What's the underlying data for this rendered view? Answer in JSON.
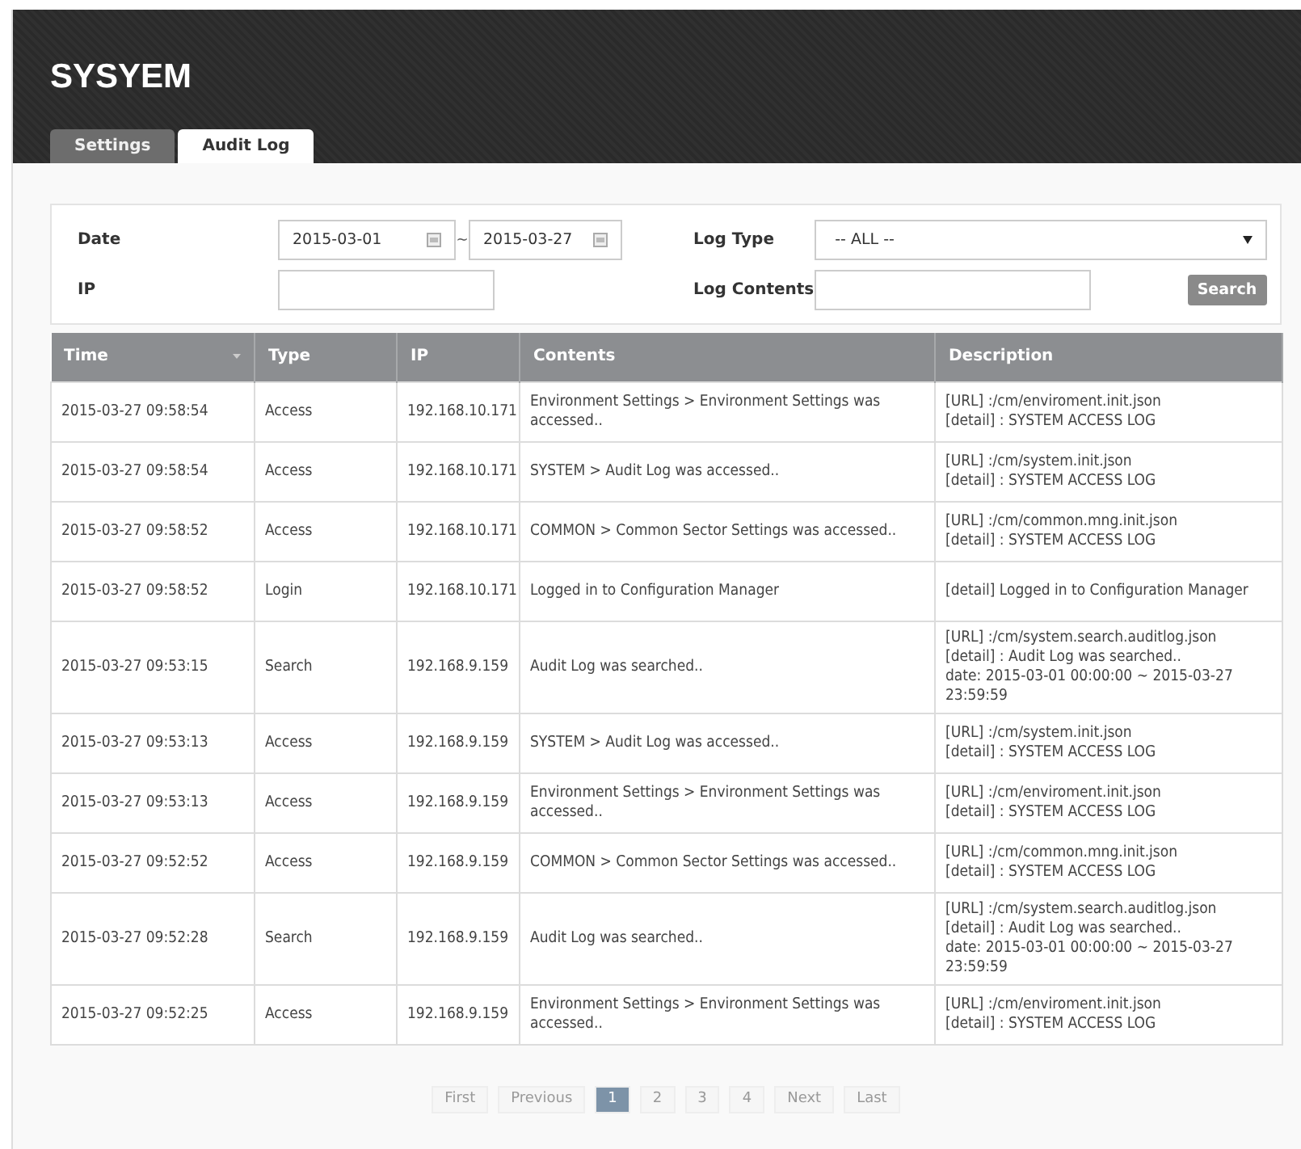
{
  "header": {
    "title": "SYSYEM"
  },
  "tabs": [
    {
      "label": "Settings",
      "selected": false
    },
    {
      "label": "Audit Log",
      "selected": true
    }
  ],
  "filters": {
    "date_label": "Date",
    "date_from": "2015-03-01",
    "date_sep": "~",
    "date_to": "2015-03-27",
    "ip_label": "IP",
    "log_type_label": "Log Type",
    "log_type_value": "-- ALL --",
    "log_contents_label": "Log Contents",
    "search_button": "Search"
  },
  "table": {
    "columns": [
      {
        "label": "Time",
        "sortable": true
      },
      {
        "label": "Type",
        "sortable": false
      },
      {
        "label": "IP",
        "sortable": false
      },
      {
        "label": "Contents",
        "sortable": false
      },
      {
        "label": "Description",
        "sortable": false
      }
    ],
    "rows": [
      {
        "time": "2015-03-27 09:58:54",
        "type": "Access",
        "ip": "192.168.10.171",
        "contents": "Environment Settings > Environment Settings was accessed..",
        "description": [
          "[URL] :/cm/enviroment.init.json",
          "[detail] : SYSTEM ACCESS LOG"
        ]
      },
      {
        "time": "2015-03-27 09:58:54",
        "type": "Access",
        "ip": "192.168.10.171",
        "contents": "SYSTEM > Audit Log was accessed..",
        "description": [
          "[URL] :/cm/system.init.json",
          "[detail] : SYSTEM ACCESS LOG"
        ]
      },
      {
        "time": "2015-03-27 09:58:52",
        "type": "Access",
        "ip": "192.168.10.171",
        "contents": "COMMON > Common Sector Settings was accessed..",
        "description": [
          "[URL] :/cm/common.mng.init.json",
          "[detail] : SYSTEM ACCESS LOG"
        ]
      },
      {
        "time": "2015-03-27 09:58:52",
        "type": "Login",
        "ip": "192.168.10.171",
        "contents": "Logged in to Configuration Manager",
        "description": [
          "[detail] Logged in to Configuration Manager"
        ]
      },
      {
        "time": "2015-03-27 09:53:15",
        "type": "Search",
        "ip": "192.168.9.159",
        "contents": "Audit Log was searched..",
        "description": [
          "[URL] :/cm/system.search.auditlog.json",
          "[detail] : Audit Log was searched..",
          "date: 2015-03-01 00:00:00 ~ 2015-03-27 23:59:59"
        ]
      },
      {
        "time": "2015-03-27 09:53:13",
        "type": "Access",
        "ip": "192.168.9.159",
        "contents": "SYSTEM > Audit Log was accessed..",
        "description": [
          "[URL] :/cm/system.init.json",
          "[detail] : SYSTEM ACCESS LOG"
        ]
      },
      {
        "time": "2015-03-27 09:53:13",
        "type": "Access",
        "ip": "192.168.9.159",
        "contents": "Environment Settings > Environment Settings was accessed..",
        "description": [
          "[URL] :/cm/enviroment.init.json",
          "[detail] : SYSTEM ACCESS LOG"
        ]
      },
      {
        "time": "2015-03-27 09:52:52",
        "type": "Access",
        "ip": "192.168.9.159",
        "contents": "COMMON > Common Sector Settings was accessed..",
        "description": [
          "[URL] :/cm/common.mng.init.json",
          "[detail] : SYSTEM ACCESS LOG"
        ]
      },
      {
        "time": "2015-03-27 09:52:28",
        "type": "Search",
        "ip": "192.168.9.159",
        "contents": "Audit Log was searched..",
        "description": [
          "[URL] :/cm/system.search.auditlog.json",
          "[detail] : Audit Log was searched..",
          "date: 2015-03-01 00:00:00 ~ 2015-03-27 23:59:59"
        ]
      },
      {
        "time": "2015-03-27 09:52:25",
        "type": "Access",
        "ip": "192.168.9.159",
        "contents": "Environment Settings > Environment Settings was accessed..",
        "description": [
          "[URL] :/cm/enviroment.init.json",
          "[detail] : SYSTEM ACCESS LOG"
        ]
      }
    ]
  },
  "pagination": [
    {
      "label": "First",
      "selected": false
    },
    {
      "label": "Previous",
      "selected": false
    },
    {
      "label": "1",
      "selected": true
    },
    {
      "label": "2",
      "selected": false
    },
    {
      "label": "3",
      "selected": false
    },
    {
      "label": "4",
      "selected": false
    },
    {
      "label": "Next",
      "selected": false
    },
    {
      "label": "Last",
      "selected": false
    }
  ]
}
